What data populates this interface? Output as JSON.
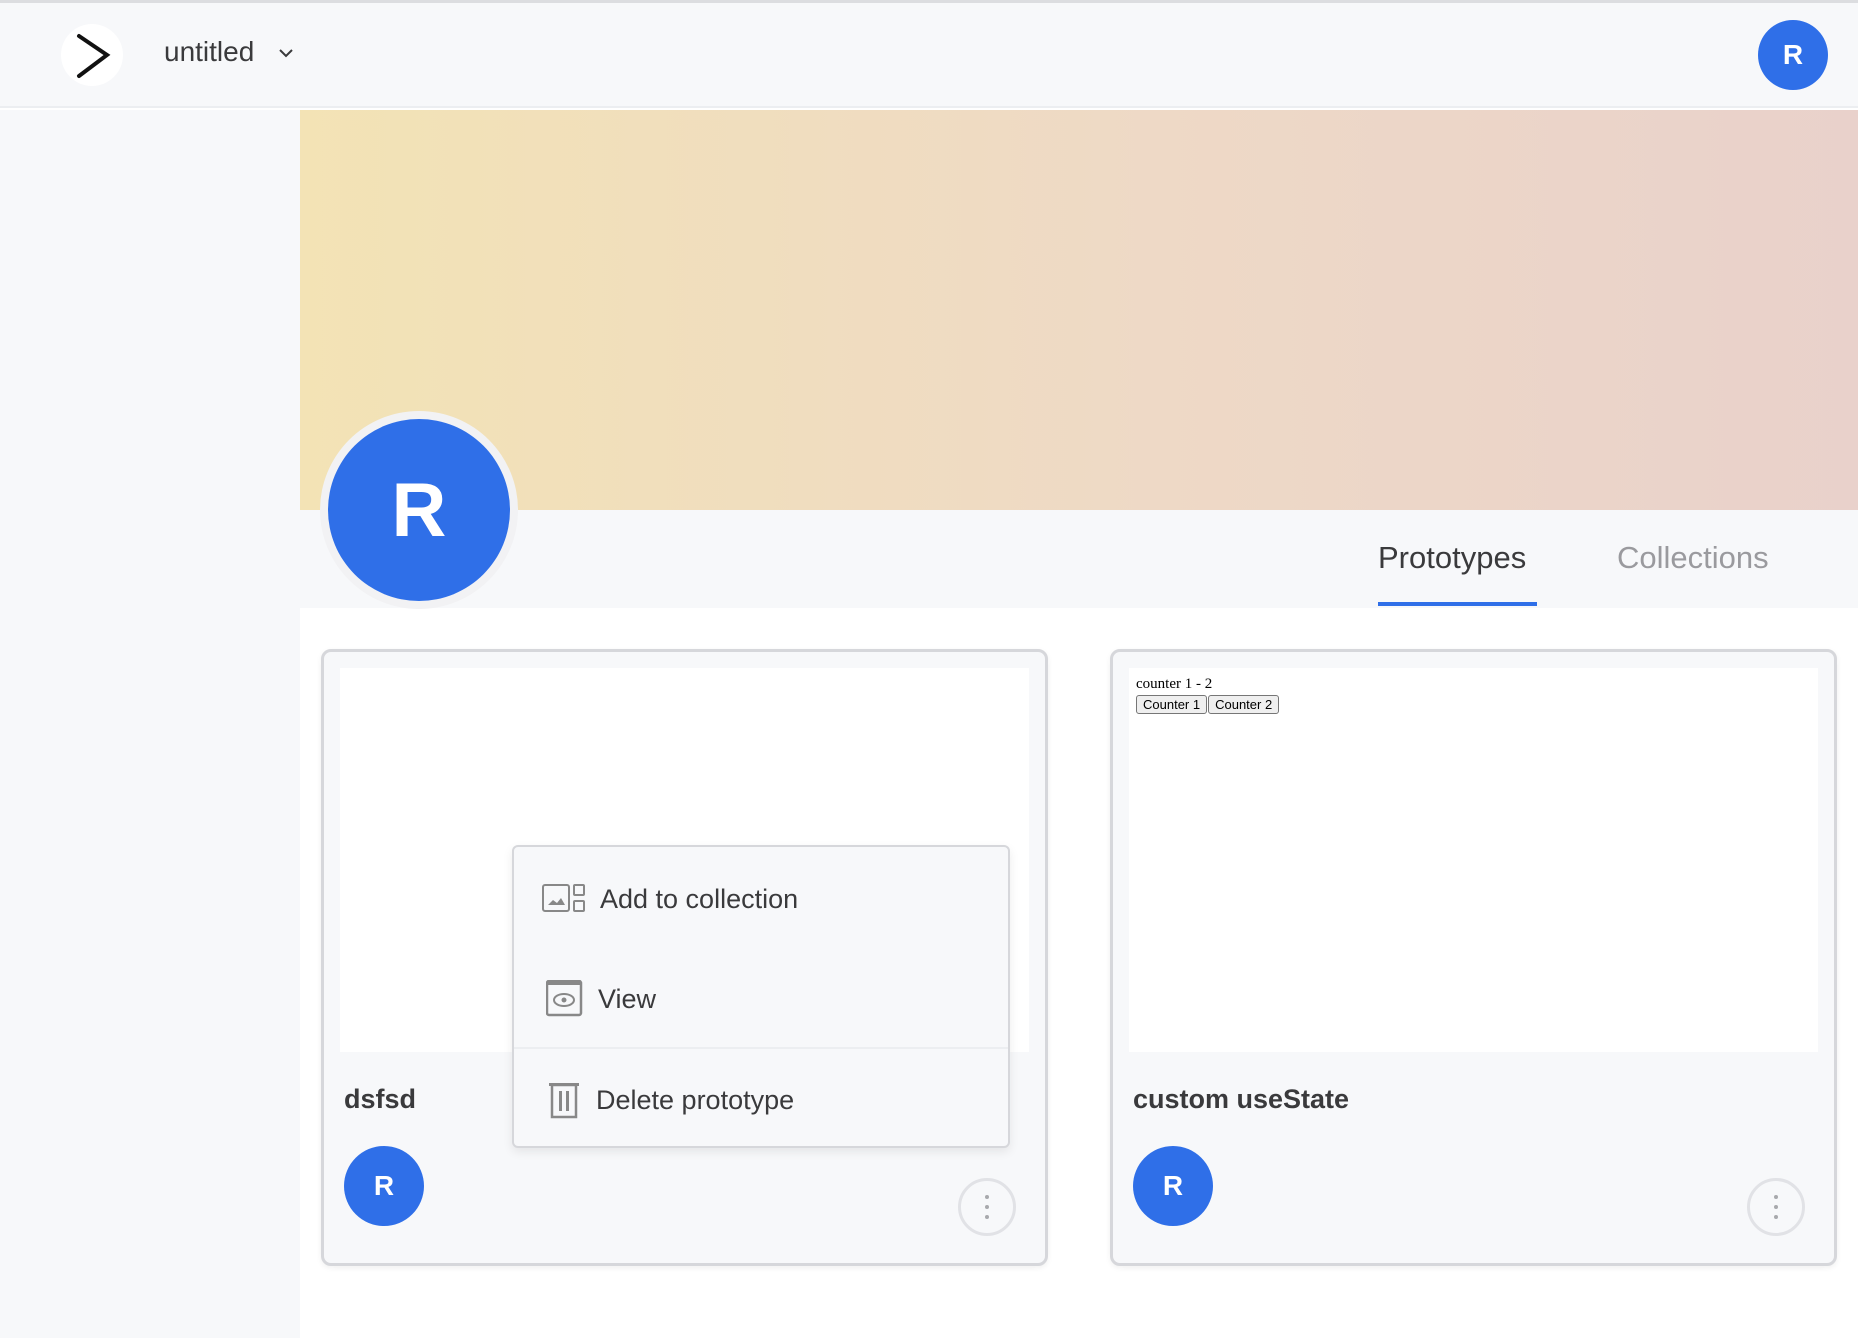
{
  "header": {
    "project_title": "untitled",
    "user_initial": "R",
    "logo_icon": "chevron-right-logo"
  },
  "profile": {
    "initial": "R",
    "accent": "#2f6fe8"
  },
  "tabs": [
    {
      "label": "Prototypes",
      "active": true
    },
    {
      "label": "Collections",
      "active": false
    }
  ],
  "cards": [
    {
      "title": "dsfsd",
      "author_initial": "R",
      "preview": null
    },
    {
      "title": "custom useState",
      "author_initial": "R",
      "preview": {
        "text": "counter 1 - 2",
        "buttons": [
          "Counter 1",
          "Counter 2"
        ]
      }
    }
  ],
  "context_menu": {
    "items": [
      {
        "label": "Add to collection",
        "icon": "add-collection-icon"
      },
      {
        "label": "View",
        "icon": "view-icon"
      },
      {
        "label": "Delete prototype",
        "icon": "trash-icon"
      }
    ]
  }
}
